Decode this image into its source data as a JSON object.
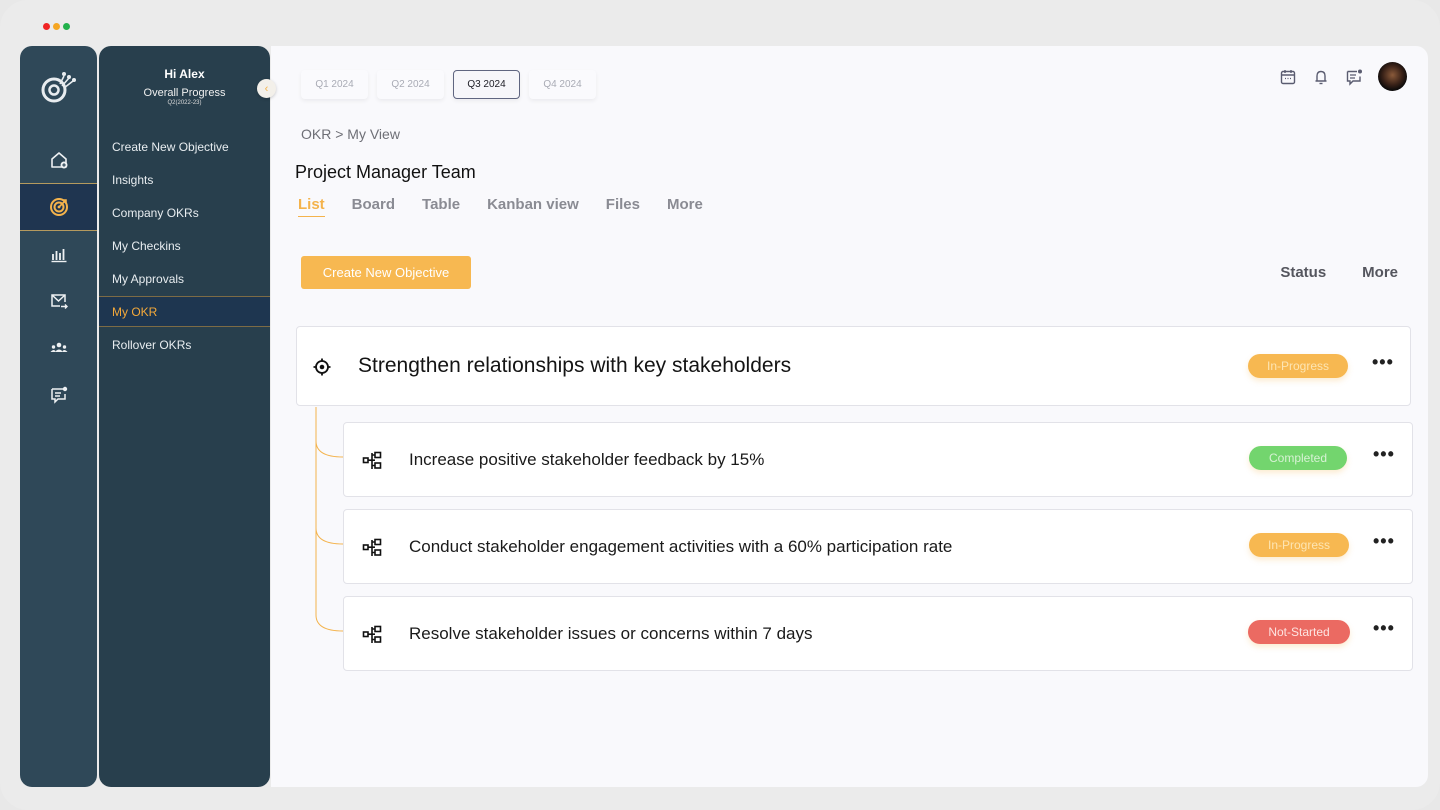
{
  "window": {
    "traffic_lights": [
      "close",
      "minimize",
      "maximize"
    ]
  },
  "rail": {
    "logo": "target-logo-icon",
    "items": [
      {
        "icon": "home-add-icon",
        "active": false
      },
      {
        "icon": "target-icon",
        "active": true
      },
      {
        "icon": "bar-chart-icon",
        "active": false
      },
      {
        "icon": "mail-forward-icon",
        "active": false
      },
      {
        "icon": "team-icon",
        "active": false
      },
      {
        "icon": "chat-notification-icon",
        "active": false
      }
    ]
  },
  "subnav": {
    "greeting": "Hi Alex",
    "progress_label": "Overall Progress",
    "period": "Q2(2022-23)",
    "collapse_icon": "chevron-left-icon",
    "items": [
      {
        "label": "Create New Objective",
        "active": false
      },
      {
        "label": "Insights",
        "active": false
      },
      {
        "label": "Company OKRs",
        "active": false
      },
      {
        "label": "My  Checkins",
        "active": false
      },
      {
        "label": "My Approvals",
        "active": false
      },
      {
        "label": "My OKR",
        "active": true
      },
      {
        "label": "Rollover OKRs",
        "active": false
      }
    ]
  },
  "header": {
    "quarters": [
      {
        "label": "Q1 2024",
        "active": false
      },
      {
        "label": "Q2 2024",
        "active": false
      },
      {
        "label": "Q3 2024",
        "active": true
      },
      {
        "label": "Q4 2024",
        "active": false
      }
    ],
    "icons": [
      "calendar-icon",
      "bell-icon",
      "message-icon",
      "user-avatar"
    ]
  },
  "main": {
    "breadcrumb": "OKR > My View",
    "title": "Project Manager Team",
    "tabs": [
      {
        "label": "List",
        "active": true
      },
      {
        "label": "Board",
        "active": false
      },
      {
        "label": "Table",
        "active": false
      },
      {
        "label": "Kanban view",
        "active": false
      },
      {
        "label": "Files",
        "active": false
      },
      {
        "label": "More",
        "active": false
      }
    ],
    "create_button": "Create New Objective",
    "status_label": "Status",
    "more_label": "More",
    "objective": {
      "title": "Strengthen relationships with key stakeholders",
      "status": "In-Progress",
      "menu": "•••"
    },
    "key_results": [
      {
        "title": "Increase positive stakeholder feedback by 15%",
        "status": "Completed",
        "menu": "•••"
      },
      {
        "title": "Conduct stakeholder engagement activities with a 60% participation rate",
        "status": "In-Progress",
        "menu": "•••"
      },
      {
        "title": "Resolve stakeholder issues or concerns within 7 days",
        "status": "Not-Started",
        "menu": "•••"
      }
    ],
    "status_colors": {
      "In-Progress": "#f7b851",
      "Completed": "#73d56e",
      "Not-Started": "#eb6a62"
    }
  }
}
